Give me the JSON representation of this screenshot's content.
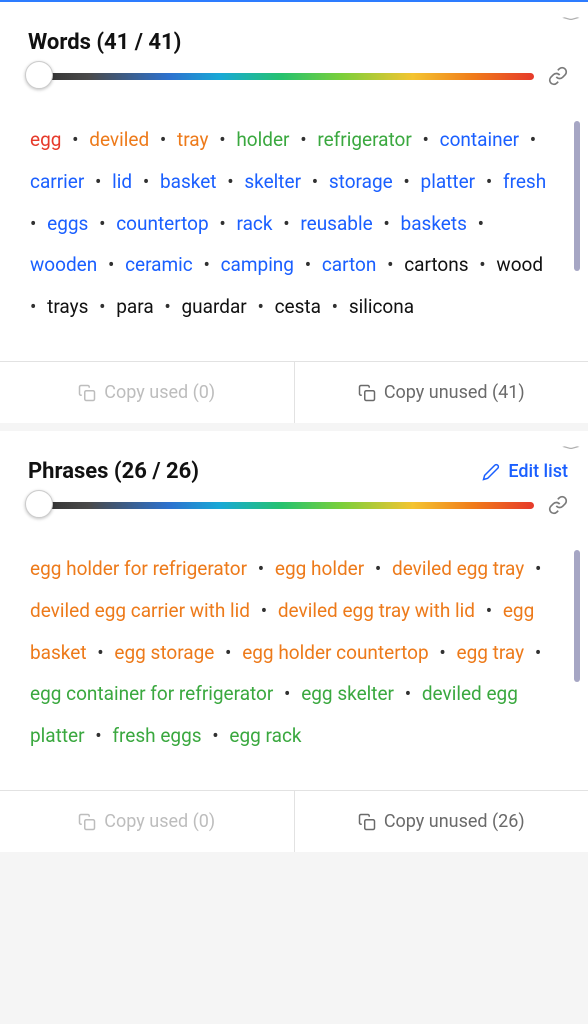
{
  "words_panel": {
    "title": "Words (41 / 41)",
    "copy_used": "Copy used (0)",
    "copy_unused": "Copy unused (41)",
    "tags": [
      {
        "t": "egg",
        "c": "c-red"
      },
      {
        "t": "deviled",
        "c": "c-orange"
      },
      {
        "t": "tray",
        "c": "c-orange"
      },
      {
        "t": "holder",
        "c": "c-green"
      },
      {
        "t": "refrigerator",
        "c": "c-green"
      },
      {
        "t": "container",
        "c": "c-blue"
      },
      {
        "t": "carrier",
        "c": "c-blue"
      },
      {
        "t": "lid",
        "c": "c-blue"
      },
      {
        "t": "basket",
        "c": "c-blue"
      },
      {
        "t": "skelter",
        "c": "c-blue"
      },
      {
        "t": "storage",
        "c": "c-blue"
      },
      {
        "t": "platter",
        "c": "c-blue"
      },
      {
        "t": "fresh",
        "c": "c-blue"
      },
      {
        "t": "eggs",
        "c": "c-blue"
      },
      {
        "t": "countertop",
        "c": "c-blue"
      },
      {
        "t": "rack",
        "c": "c-blue"
      },
      {
        "t": "reusable",
        "c": "c-blue"
      },
      {
        "t": "baskets",
        "c": "c-blue"
      },
      {
        "t": "wooden",
        "c": "c-blue"
      },
      {
        "t": "ceramic",
        "c": "c-blue"
      },
      {
        "t": "camping",
        "c": "c-blue"
      },
      {
        "t": "carton",
        "c": "c-blue"
      },
      {
        "t": "cartons",
        "c": "c-black"
      },
      {
        "t": "wood",
        "c": "c-black"
      },
      {
        "t": "trays",
        "c": "c-black"
      },
      {
        "t": "para",
        "c": "c-black"
      },
      {
        "t": "guardar",
        "c": "c-black"
      },
      {
        "t": "cesta",
        "c": "c-black"
      },
      {
        "t": "silicona",
        "c": "c-black"
      }
    ]
  },
  "phrases_panel": {
    "title": "Phrases (26 / 26)",
    "edit": "Edit list",
    "copy_used": "Copy used (0)",
    "copy_unused": "Copy unused (26)",
    "tags": [
      {
        "t": "egg holder for refrigerator",
        "c": "c-orange"
      },
      {
        "t": "egg holder",
        "c": "c-orange"
      },
      {
        "t": "deviled egg tray",
        "c": "c-orange"
      },
      {
        "t": "deviled egg carrier with lid",
        "c": "c-orange"
      },
      {
        "t": "deviled egg tray with lid",
        "c": "c-orange"
      },
      {
        "t": "egg basket",
        "c": "c-orange"
      },
      {
        "t": "egg storage",
        "c": "c-orange"
      },
      {
        "t": "egg holder countertop",
        "c": "c-orange"
      },
      {
        "t": "egg tray",
        "c": "c-orange"
      },
      {
        "t": "egg container for refrigerator",
        "c": "c-green"
      },
      {
        "t": "egg skelter",
        "c": "c-green"
      },
      {
        "t": "deviled egg platter",
        "c": "c-green"
      },
      {
        "t": "fresh eggs",
        "c": "c-green"
      },
      {
        "t": "egg rack",
        "c": "c-green"
      }
    ]
  }
}
